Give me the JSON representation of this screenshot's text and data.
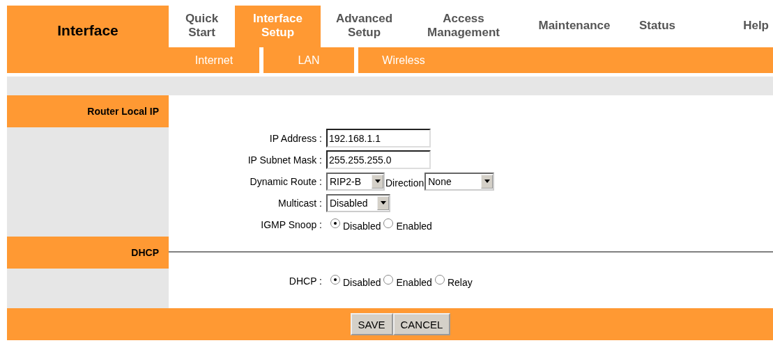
{
  "header": {
    "title": "Interface"
  },
  "tabs": [
    {
      "label": "Quick Start",
      "selected": false
    },
    {
      "label": "Interface Setup",
      "selected": true
    },
    {
      "label": "Advanced Setup",
      "selected": false
    },
    {
      "label": "Access Management",
      "selected": false
    },
    {
      "label": "Maintenance",
      "selected": false
    },
    {
      "label": "Status",
      "selected": false
    },
    {
      "label": "Help",
      "selected": false
    }
  ],
  "subtabs": [
    "Internet",
    "LAN",
    "Wireless"
  ],
  "sections": [
    {
      "title": "Router Local IP",
      "rows": [
        {
          "kind": "text",
          "label": "IP Address :",
          "value": "192.168.1.1"
        },
        {
          "kind": "text",
          "label": "IP Subnet Mask :",
          "value": "255.255.255.0"
        },
        {
          "kind": "route",
          "label": "Dynamic Route :",
          "value": "RIP2-B",
          "extra_label": "Direction",
          "extra_value": "None"
        },
        {
          "kind": "select",
          "label": "Multicast :",
          "value": "Disabled"
        },
        {
          "kind": "radio",
          "label": "IGMP Snoop :",
          "options": [
            {
              "label": "Disabled",
              "checked": true
            },
            {
              "label": "Enabled",
              "checked": false
            }
          ]
        }
      ]
    },
    {
      "title": "DHCP",
      "rows": [
        {
          "kind": "radio",
          "label": "DHCP :",
          "options": [
            {
              "label": "Disabled",
              "checked": true
            },
            {
              "label": "Enabled",
              "checked": false
            },
            {
              "label": "Relay",
              "checked": false
            }
          ]
        }
      ]
    }
  ],
  "buttons": [
    "SAVE",
    "CANCEL"
  ]
}
